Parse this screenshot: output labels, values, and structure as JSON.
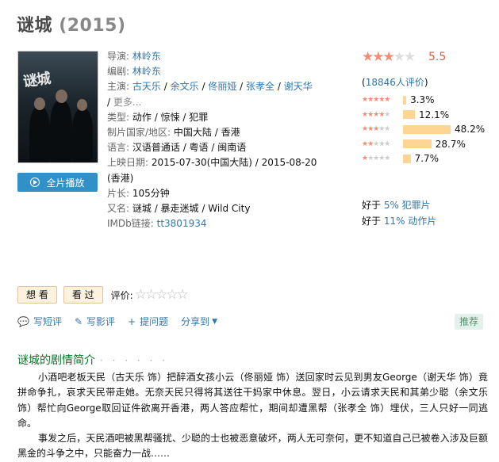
{
  "movie": {
    "title": "谜城",
    "year": "(2015)"
  },
  "poster": {
    "title_text": "谜城"
  },
  "play_button": {
    "label": "全片播放"
  },
  "info": {
    "director_label": "导演:",
    "director": "林岭东",
    "writer_label": "编剧:",
    "writer": "林岭东",
    "cast_label": "主演:",
    "cast": [
      "古天乐",
      "余文乐",
      "佟丽娅",
      "张孝全",
      "谢天华"
    ],
    "cast_more": "更多...",
    "genre_label": "类型:",
    "genres": [
      "动作",
      "惊悚",
      "犯罪"
    ],
    "country_label": "制片国家/地区:",
    "country": "中国大陆 / 香港",
    "language_label": "语言:",
    "language": "汉语普通话 / 粤语 / 闽南语",
    "release_label": "上映日期:",
    "release_1": "2015-07-30(中国大陆)",
    "release_sep": " / ",
    "release_2": "2015-08-20",
    "release_2_region": "(香港)",
    "runtime_label": "片长:",
    "runtime": "105分钟",
    "aka_label": "又名:",
    "aka": "谜城 / 暴走迷城 / Wild City",
    "imdb_label": "IMDb链接:",
    "imdb": "tt3801934"
  },
  "rating": {
    "score": "5.5",
    "votes_open": "(",
    "votes": "18846人评价",
    "votes_close": ")",
    "stars_shown": 2.5,
    "distribution": [
      {
        "stars": 5,
        "percent": 3.3,
        "label": "3.3%"
      },
      {
        "stars": 4,
        "percent": 12.1,
        "label": "12.1%"
      },
      {
        "stars": 3,
        "percent": 48.2,
        "label": "48.2%"
      },
      {
        "stars": 2,
        "percent": 28.7,
        "label": "28.7%"
      },
      {
        "stars": 1,
        "percent": 7.7,
        "label": "7.7%"
      }
    ],
    "bar_color": "#ffd596"
  },
  "better_than": [
    {
      "prefix": "好于 ",
      "value": "5% 犯罪片"
    },
    {
      "prefix": "好于 ",
      "value": "11% 动作片"
    }
  ],
  "actions": {
    "want": "想 看",
    "seen": "看 过",
    "rate_label": "评价:"
  },
  "links": {
    "short_review": "写短评",
    "review": "写影评",
    "ask": "提问题",
    "share": "分享到",
    "recommend": "推荐"
  },
  "summary": {
    "heading": "谜城的剧情简介",
    "dots": "· · · · · ·",
    "p1": "小酒吧老板天民（古天乐 饰）把醉酒女孩小云（佟丽娅 饰）送回家时云见到男友George（谢天华 饰）竟拼命争扎，哀求天民带走她。无奈天民只得将其送往干妈家中休息。翌日，小云请求天民和其弟少聪（余文乐 饰）帮忙向George取回证件欲离开香港，两人答应帮忙，期间却遭黑帮（张孝全 饰）埋伏，三人只好一同逃命。",
    "p2": "事发之后，天民酒吧被黑帮骚扰、少聪的士也被恶意破坏，两人无可奈何，更不知道自己已被卷入涉及巨额黑金的斗争之中，只能奋力一战……"
  },
  "colors": {
    "link": "#3377aa",
    "star": "#f38d74",
    "score": "#e05a48",
    "green_heading": "#007722",
    "play": "#3190c7"
  }
}
